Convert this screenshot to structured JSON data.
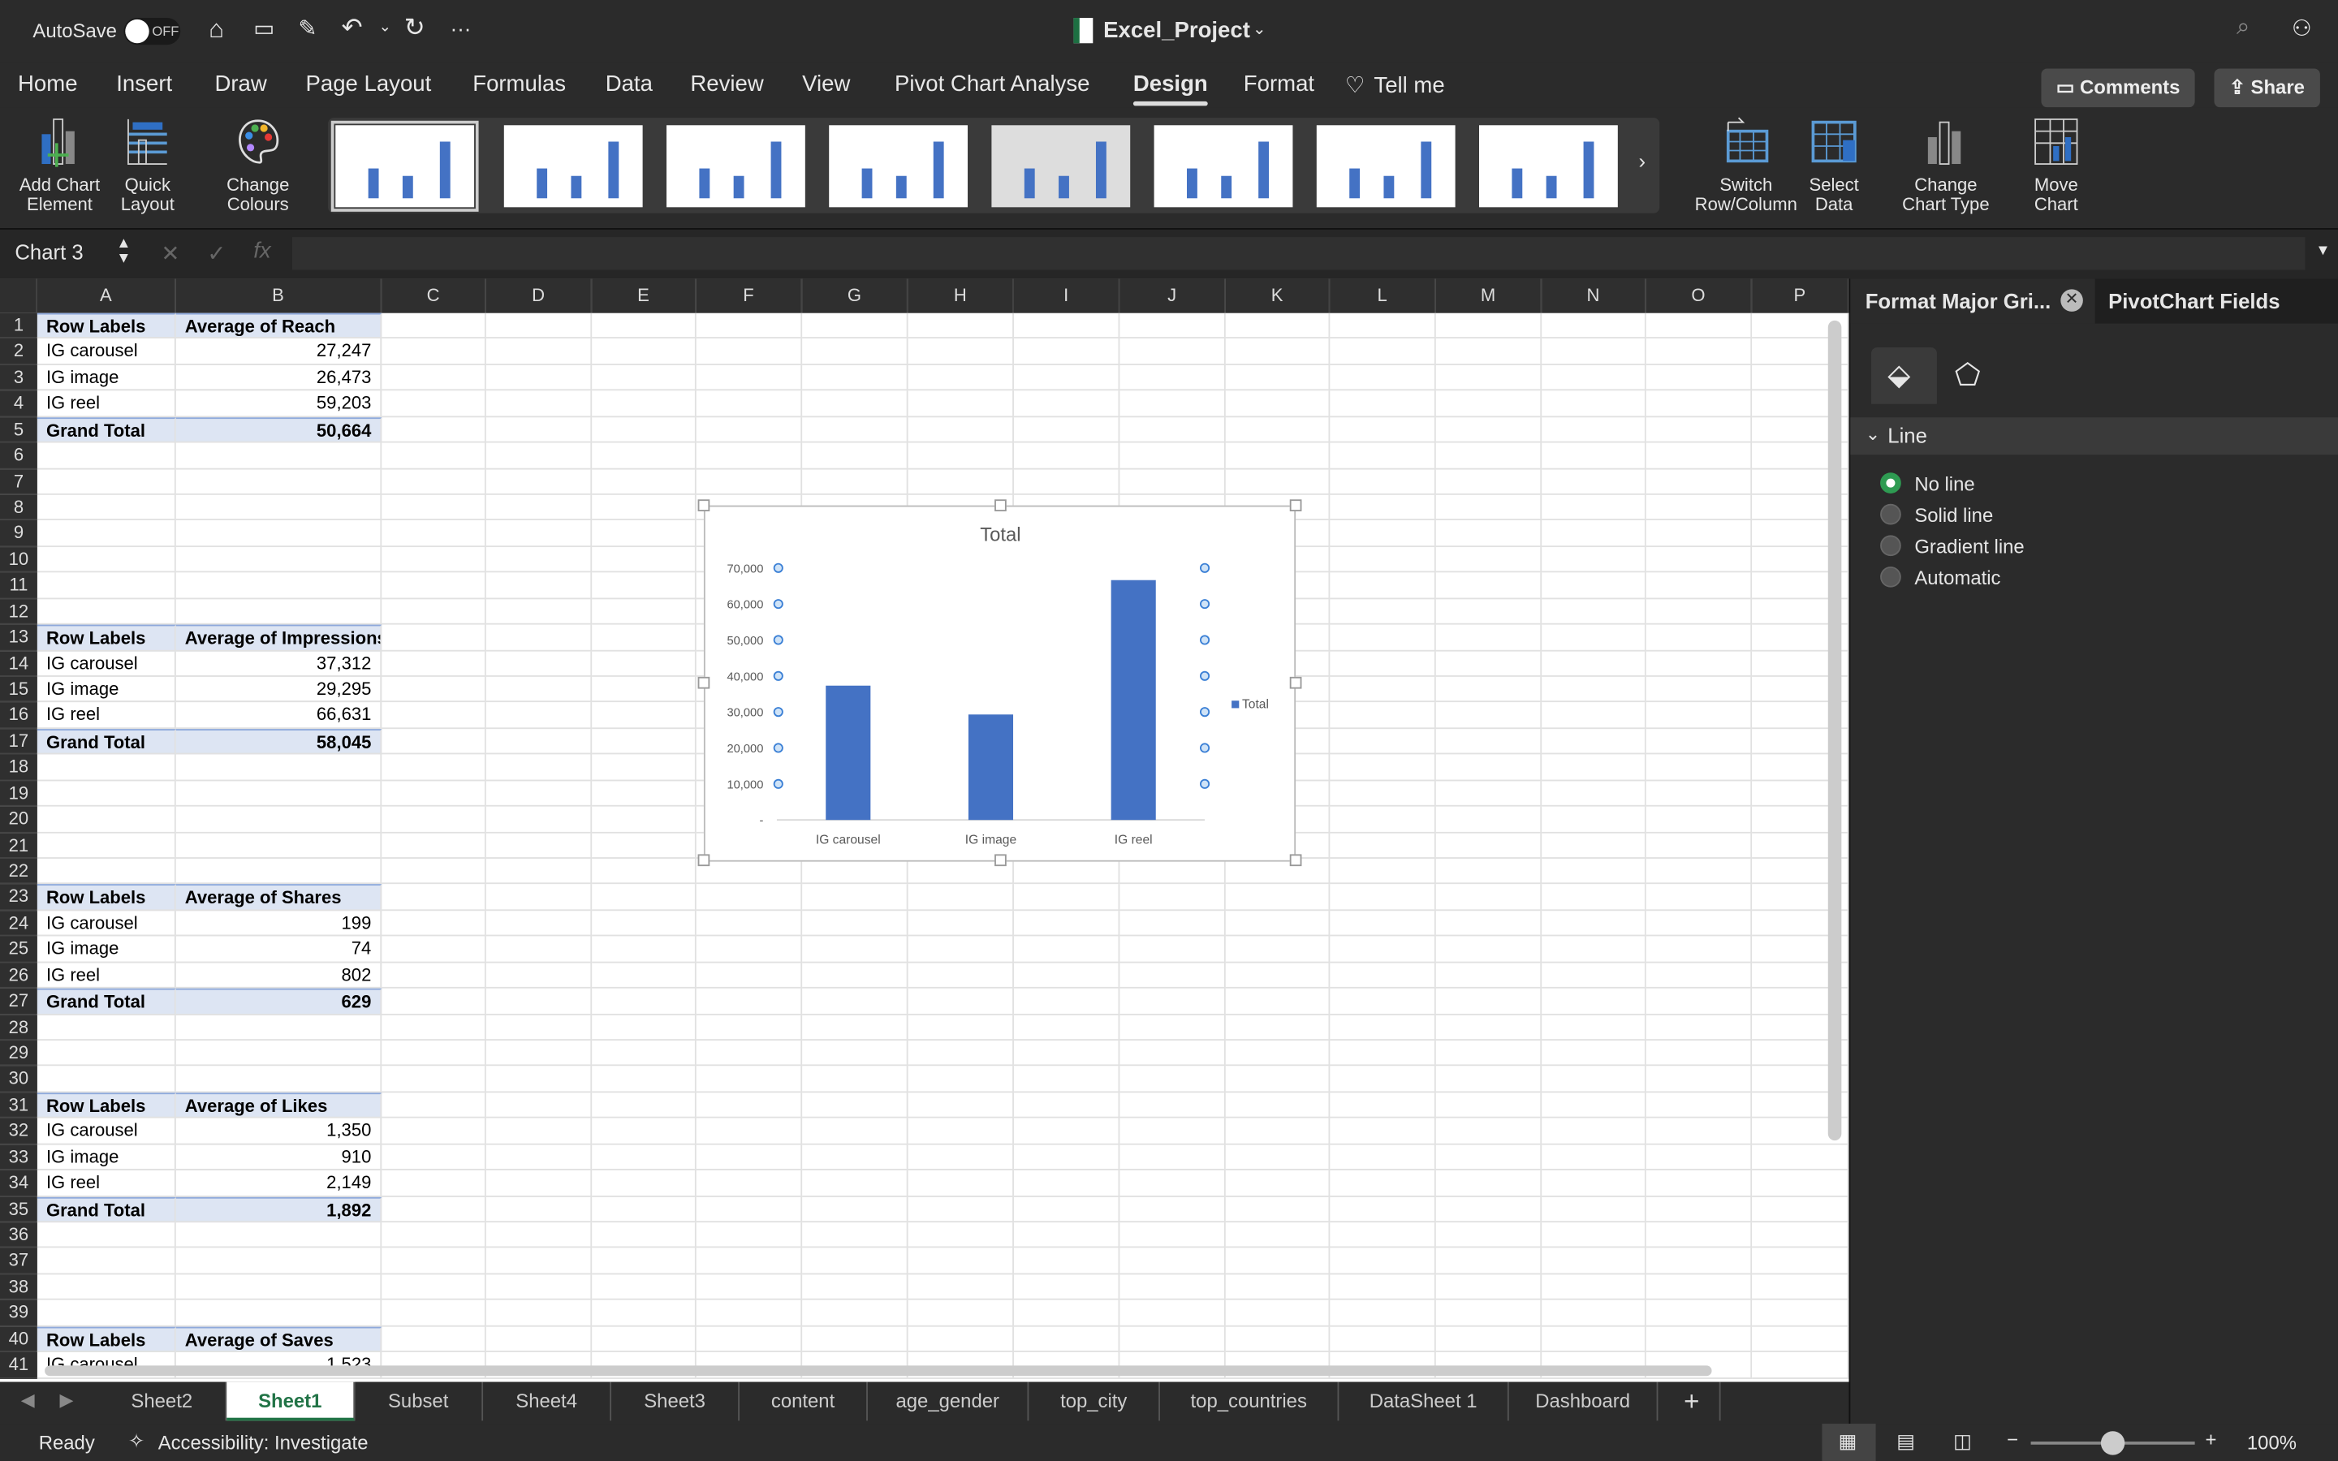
{
  "titlebar": {
    "autosave_label": "AutoSave",
    "autosave_state": "OFF",
    "file_name": "Excel_Project",
    "more": "···"
  },
  "tabs": [
    "Home",
    "Insert",
    "Draw",
    "Page Layout",
    "Formulas",
    "Data",
    "Review",
    "View",
    "Pivot Chart Analyse",
    "Design",
    "Format"
  ],
  "active_tab": "Design",
  "tell_me": "Tell me",
  "comments_label": "Comments",
  "share_label": "Share",
  "ribbon": {
    "add_chart_element": [
      "Add Chart",
      "Element"
    ],
    "quick_layout": [
      "Quick",
      "Layout"
    ],
    "change_colours": [
      "Change",
      "Colours"
    ],
    "switch_row_column": [
      "Switch",
      "Row/Column"
    ],
    "select_data": [
      "Select",
      "Data"
    ],
    "change_chart_type": [
      "Change",
      "Chart Type"
    ],
    "move_chart": [
      "Move",
      "Chart"
    ]
  },
  "formula_bar": {
    "name_box": "Chart 3",
    "fx": "fx",
    "value": ""
  },
  "columns": [
    "A",
    "B",
    "C",
    "D",
    "E",
    "F",
    "G",
    "H",
    "I",
    "J",
    "K",
    "L",
    "M",
    "N",
    "O",
    "P"
  ],
  "pivots": [
    {
      "row": 1,
      "label": "Row Labels",
      "measure": "Average of Reach",
      "items": [
        [
          "IG carousel",
          "27,247"
        ],
        [
          "IG image",
          "26,473"
        ],
        [
          "IG reel",
          "59,203"
        ]
      ],
      "total": [
        "Grand Total",
        "50,664"
      ]
    },
    {
      "row": 13,
      "label": "Row Labels",
      "measure": "Average of Impressions",
      "items": [
        [
          "IG carousel",
          "37,312"
        ],
        [
          "IG image",
          "29,295"
        ],
        [
          "IG reel",
          "66,631"
        ]
      ],
      "total": [
        "Grand Total",
        "58,045"
      ]
    },
    {
      "row": 23,
      "label": "Row Labels",
      "measure": "Average of Shares",
      "items": [
        [
          "IG carousel",
          "199"
        ],
        [
          "IG image",
          "74"
        ],
        [
          "IG reel",
          "802"
        ]
      ],
      "total": [
        "Grand Total",
        "629"
      ]
    },
    {
      "row": 31,
      "label": "Row Labels",
      "measure": "Average of Likes",
      "items": [
        [
          "IG carousel",
          "1,350"
        ],
        [
          "IG image",
          "910"
        ],
        [
          "IG reel",
          "2,149"
        ]
      ],
      "total": [
        "Grand Total",
        "1,892"
      ]
    },
    {
      "row": 40,
      "label": "Row Labels",
      "measure": "Average of Saves",
      "items": [
        [
          "IG carousel",
          "1,523"
        ]
      ],
      "total": null
    }
  ],
  "chart_data": {
    "type": "bar",
    "title": "Total",
    "categories": [
      "IG carousel",
      "IG image",
      "IG reel"
    ],
    "series": [
      {
        "name": "Total",
        "values": [
          37312,
          29295,
          66631
        ]
      }
    ],
    "yticks": [
      "-",
      "10,000",
      "20,000",
      "30,000",
      "40,000",
      "50,000",
      "60,000",
      "70,000"
    ],
    "ylim": [
      0,
      70000
    ],
    "legend": "right",
    "grid": false,
    "color": "#4472c4"
  },
  "sheet_tabs": [
    "Sheet2",
    "Sheet1",
    "Subset",
    "Sheet4",
    "Sheet3",
    "content",
    "age_gender",
    "top_city",
    "top_countries",
    "DataSheet 1",
    "Dashboard"
  ],
  "active_sheet": "Sheet1",
  "status": {
    "ready": "Ready",
    "accessibility": "Accessibility: Investigate",
    "zoom": "100%"
  },
  "panel": {
    "tab1": "Format Major Gri...",
    "tab2": "PivotChart Fields",
    "section": "Line",
    "options": [
      "No line",
      "Solid line",
      "Gradient line",
      "Automatic"
    ],
    "selected": "No line"
  }
}
